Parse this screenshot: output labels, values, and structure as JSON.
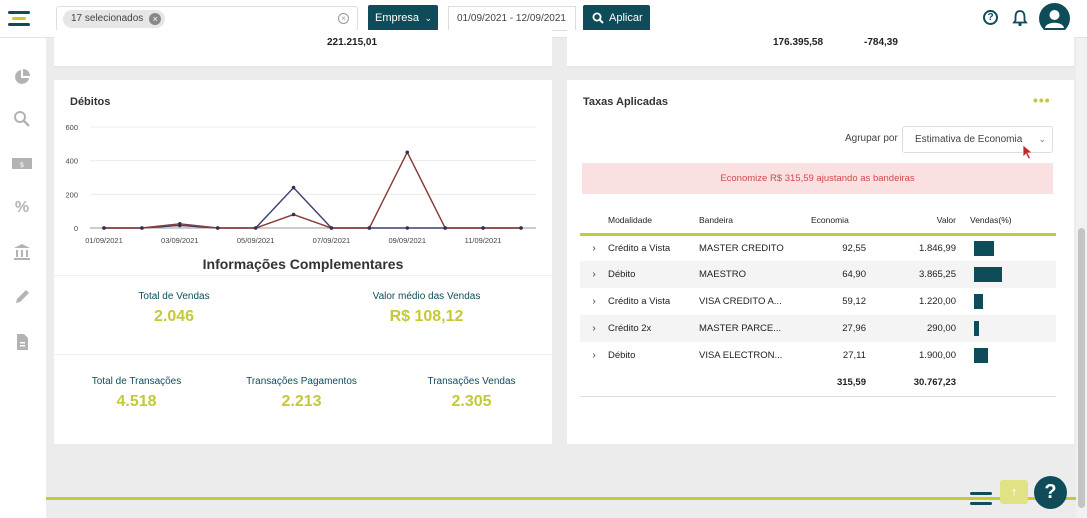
{
  "header": {
    "chip_label": "17 selecionados",
    "empresa_label": "Empresa",
    "date_range": "01/09/2021 - 12/09/2021",
    "aplicar_label": "Aplicar"
  },
  "summary": {
    "left_value": "221.215,01",
    "right_value1": "176.395,58",
    "right_value2": "-784,39"
  },
  "debitos": {
    "title": "Débitos"
  },
  "chart_data": {
    "type": "line",
    "x": [
      "01/09/2021",
      "02/09/2021",
      "03/09/2021",
      "04/09/2021",
      "05/09/2021",
      "06/09/2021",
      "07/09/2021",
      "08/09/2021",
      "09/09/2021",
      "10/09/2021",
      "11/09/2021",
      "12/09/2021"
    ],
    "x_tick_labels": [
      "01/09/2021",
      "03/09/2021",
      "05/09/2021",
      "07/09/2021",
      "09/09/2021",
      "11/09/2021"
    ],
    "y_ticks": [
      0,
      200,
      400,
      600
    ],
    "ylim": [
      0,
      600
    ],
    "series": [
      {
        "color": "#3d3f6e",
        "values": [
          0,
          0,
          15,
          0,
          0,
          240,
          0,
          0,
          0,
          0,
          0,
          0
        ]
      },
      {
        "color": "#8b3a3a",
        "values": [
          0,
          0,
          25,
          0,
          0,
          80,
          0,
          0,
          450,
          0,
          0,
          0
        ]
      }
    ]
  },
  "info": {
    "title": "Informações Complementares",
    "total_vendas_label": "Total de Vendas",
    "total_vendas_value": "2.046",
    "valor_medio_label": "Valor médio das Vendas",
    "valor_medio_value": "R$ 108,12",
    "total_transacoes_label": "Total de Transações",
    "total_transacoes_value": "4.518",
    "trans_pagamentos_label": "Transações Pagamentos",
    "trans_pagamentos_value": "2.213",
    "trans_vendas_label": "Transações Vendas",
    "trans_vendas_value": "2.305"
  },
  "taxas": {
    "title": "Taxas Aplicadas",
    "more": "•••",
    "agrupar_label": "Agrupar por",
    "agrupar_value": "Estimativa de Economia",
    "alert": "Economize R$ 315,59 ajustando as bandeiras",
    "columns": [
      "Modalidade",
      "Bandeira",
      "Economia",
      "Valor",
      "Vendas(%)"
    ],
    "rows": [
      {
        "modalidade": "Crédito a Vista",
        "bandeira": "MASTER CREDITO",
        "economia": "92,55",
        "valor": "1.846,99",
        "vendas_pct": 0.72
      },
      {
        "modalidade": "Débito",
        "bandeira": "MAESTRO",
        "economia": "64,90",
        "valor": "3.865,25",
        "vendas_pct": 1.0
      },
      {
        "modalidade": "Crédito a Vista",
        "bandeira": "VISA CREDITO A...",
        "economia": "59,12",
        "valor": "1.220,00",
        "vendas_pct": 0.32
      },
      {
        "modalidade": "Crédito 2x",
        "bandeira": "MASTER PARCE...",
        "economia": "27,96",
        "valor": "290,00",
        "vendas_pct": 0.18
      },
      {
        "modalidade": "Débito",
        "bandeira": "VISA ELECTRON...",
        "economia": "27,11",
        "valor": "1.900,00",
        "vendas_pct": 0.5
      }
    ],
    "total_economia": "315,59",
    "total_valor": "30.767,23"
  },
  "colors": {
    "primary": "#0f4c59",
    "accent": "#c5c935",
    "alert_bg": "#fbe0e1",
    "alert_text": "#d04a4e"
  }
}
